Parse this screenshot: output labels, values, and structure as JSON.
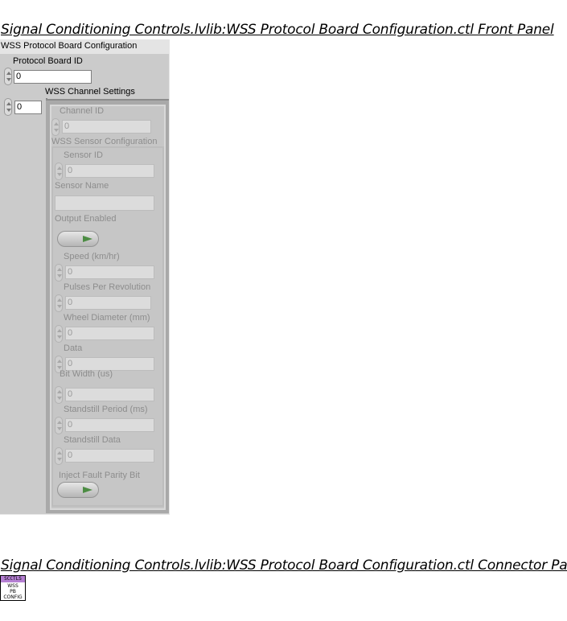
{
  "headings": {
    "front_panel": "Signal Conditioning Controls.lvlib:WSS Protocol Board Configuration.ctl Front Panel",
    "connector_pane": "Signal Conditioning Controls.lvlib:WSS Protocol Board Configuration.ctl Connector Pane"
  },
  "cluster": {
    "title": "WSS Protocol Board Configuration",
    "protocol_board_id": {
      "label": "Protocol Board ID",
      "value": "0"
    },
    "channel_settings": {
      "label": "WSS Channel Settings",
      "array_index": "0",
      "channel_id": {
        "label": "Channel ID",
        "value": "0"
      },
      "sensor_config": {
        "label": "WSS Sensor Configuration",
        "sensor_id": {
          "label": "Sensor ID",
          "value": "0"
        },
        "sensor_name": {
          "label": "Sensor Name",
          "value": ""
        },
        "output_enabled": {
          "label": "Output Enabled"
        },
        "speed": {
          "label": "Speed (km/hr)",
          "value": "0"
        },
        "pulses_per_rev": {
          "label": "Pulses Per Revolution",
          "value": "0"
        },
        "wheel_diameter": {
          "label": "Wheel Diameter (mm)",
          "value": "0"
        },
        "data": {
          "label": "Data",
          "value": "0"
        },
        "bit_width": {
          "label": "Bit Width (us)",
          "value": "0"
        },
        "standstill_period": {
          "label": "Standstill Period (ms)",
          "value": "0"
        },
        "standstill_data": {
          "label": "Standstill Data",
          "value": "0"
        },
        "inject_fault": {
          "label": "Inject Fault Parity Bit"
        }
      }
    }
  },
  "connector_icon": {
    "band_text": "SCCTLS",
    "lines": [
      "WSS",
      "PB",
      "CONFIG"
    ],
    "colors": {
      "band": "#b57fd3"
    }
  },
  "colors": {
    "panel_background": "#cbcbcb",
    "frame_dark": "#a9a9a9",
    "toggle_led": "#4c8c43"
  }
}
